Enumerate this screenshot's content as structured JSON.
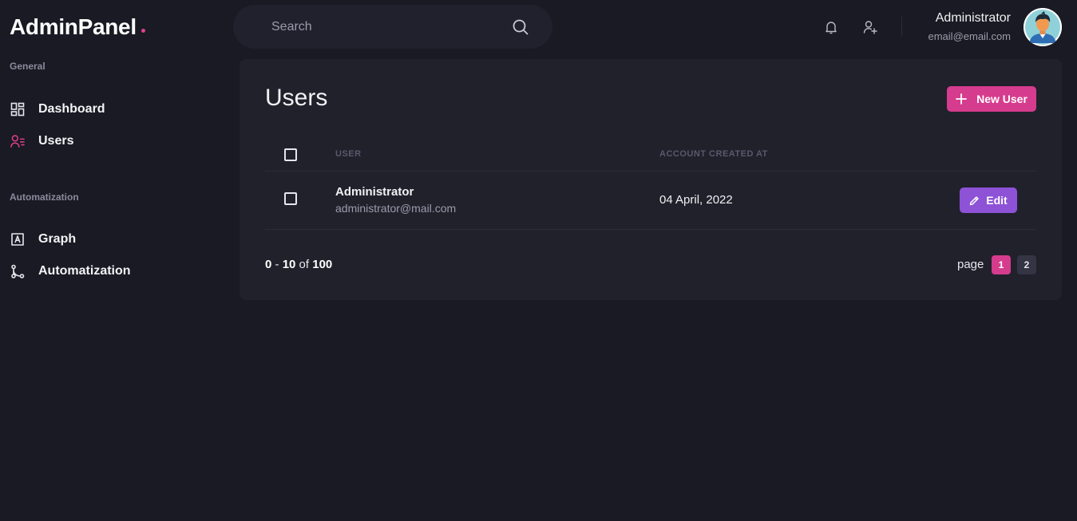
{
  "app": {
    "logo": "AdminPanel",
    "accent_color": "#d63c8d",
    "edit_color": "#8d52d6"
  },
  "sidebar": {
    "sections": [
      {
        "label": "General",
        "items": [
          {
            "label": "Dashboard",
            "icon": "dashboard-icon",
            "active": false
          },
          {
            "label": "Users",
            "icon": "users-icon",
            "active": true
          }
        ]
      },
      {
        "label": "Automatization",
        "items": [
          {
            "label": "Graph",
            "icon": "graph-icon",
            "active": false
          },
          {
            "label": "Automatization",
            "icon": "automatization-icon",
            "active": false
          }
        ]
      }
    ]
  },
  "header": {
    "search_placeholder": "Search",
    "user": {
      "name": "Administrator",
      "email": "email@email.com"
    }
  },
  "main": {
    "title": "Users",
    "new_user_label": "New User",
    "table": {
      "columns": [
        "USER",
        "ACCOUNT CREATED AT"
      ],
      "rows": [
        {
          "name": "Administrator",
          "email": "administrator@mail.com",
          "created_at": "04 April, 2022",
          "action_label": "Edit"
        }
      ]
    },
    "pagination": {
      "range_start": "0",
      "range_separator": "-",
      "range_end": "10",
      "of_label": "of",
      "total": "100",
      "page_label": "page",
      "pages": [
        "1",
        "2"
      ],
      "current_page": "1"
    }
  }
}
